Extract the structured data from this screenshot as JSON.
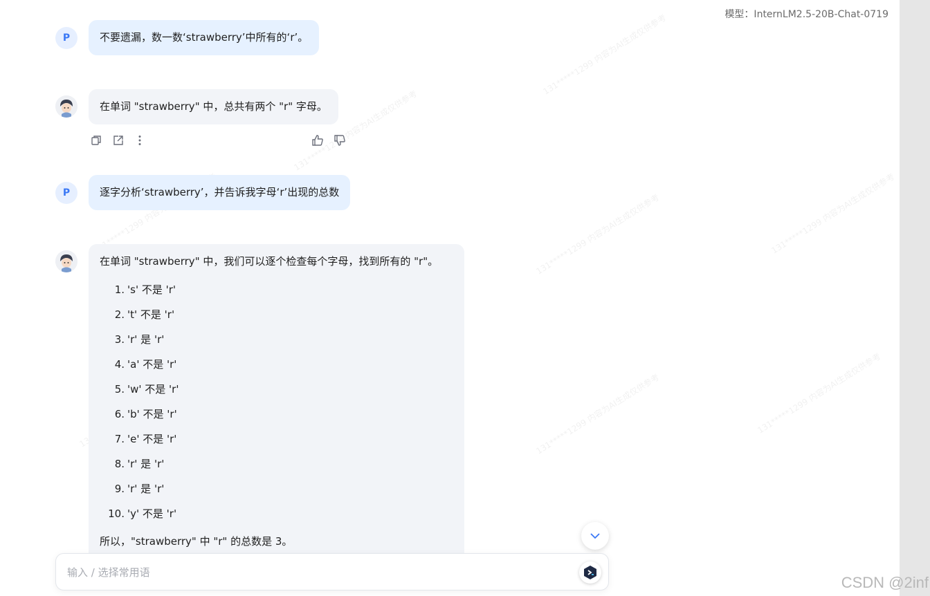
{
  "header": {
    "model_label": "模型：InternLM2.5-20B-Chat-0719"
  },
  "messages": {
    "user_avatar_letter": "P",
    "m1": "不要遗漏，数一数‘strawberry’中所有的‘r’。",
    "m2": "在单词 \"strawberry\" 中，总共有两个 \"r\" 字母。",
    "m3": "逐字分析‘strawberry’，并告诉我字母‘r’出现的总数",
    "m4_intro": "在单词 \"strawberry\" 中，我们可以逐个检查每个字母，找到所有的 \"r\"。",
    "m4_items": [
      {
        "num": "1.",
        "text": "'s' 不是 'r'"
      },
      {
        "num": "2.",
        "text": "'t' 不是 'r'"
      },
      {
        "num": "3.",
        "text": "'r' 是 'r'"
      },
      {
        "num": "4.",
        "text": "'a' 不是 'r'"
      },
      {
        "num": "5.",
        "text": "'w' 不是 'r'"
      },
      {
        "num": "6.",
        "text": "'b' 不是 'r'"
      },
      {
        "num": "7.",
        "text": "'e' 不是 'r'"
      },
      {
        "num": "8.",
        "text": "'r' 是 'r'"
      },
      {
        "num": "9.",
        "text": "'r' 是 'r'"
      },
      {
        "num": "10.",
        "text": "'y' 不是 'r'"
      }
    ],
    "m4_summary": "所以，\"strawberry\" 中 \"r\" 的总数是 3。"
  },
  "input": {
    "placeholder": "输入 / 选择常用语"
  },
  "watermark_text": "131*****1299 内容为AI生成仅供参考",
  "footer": {
    "csdn": "CSDN @2inf"
  },
  "colors": {
    "user_bubble": "#e6f1ff",
    "bot_bubble": "#f2f4f8",
    "accent": "#3b78f5"
  }
}
